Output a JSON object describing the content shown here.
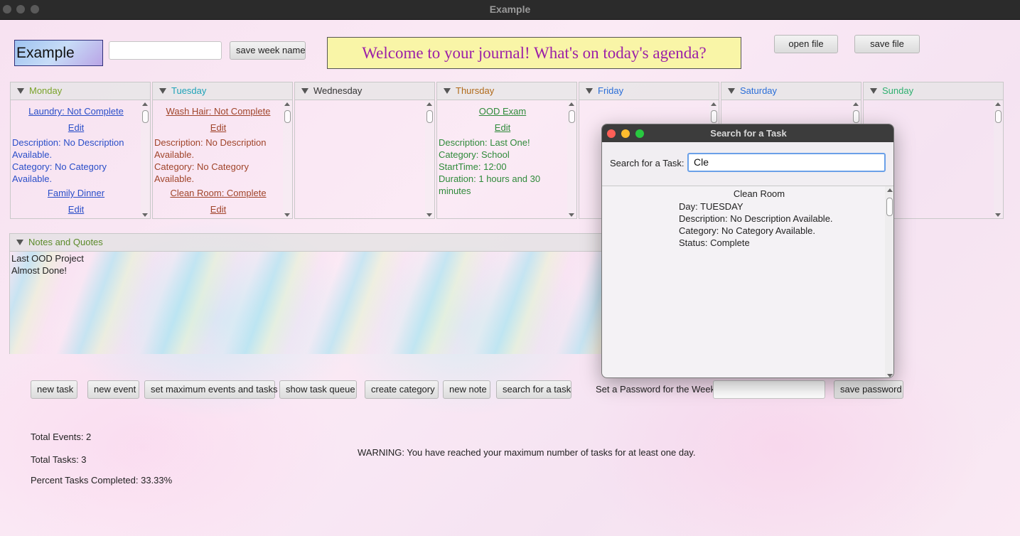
{
  "window": {
    "title": "Example"
  },
  "toolbar": {
    "week_name": "Example",
    "week_name_input_value": "",
    "save_week_name": "save week name",
    "welcome": "Welcome to your journal! What's on today's agenda?",
    "open_file": "open file",
    "save_file": "save file"
  },
  "days": [
    {
      "name": "Monday",
      "color": "#7aa32a",
      "items": [
        {
          "type": "task",
          "label": "Laundry: Not Complete",
          "color": "#2a4ec8"
        },
        {
          "type": "edit",
          "label": "Edit",
          "color": "#2a4ec8"
        },
        {
          "type": "desc",
          "lines": [
            "Description: No Description Available.",
            "Category: No Category Available."
          ],
          "color": "#2a4ec8"
        },
        {
          "type": "task",
          "label": "Family Dinner",
          "color": "#2a4ec8"
        },
        {
          "type": "edit",
          "label": "Edit",
          "color": "#2a4ec8"
        }
      ]
    },
    {
      "name": "Tuesday",
      "color": "#1fa3b8",
      "items": [
        {
          "type": "task",
          "label": "Wash Hair: Not Complete",
          "color": "#a0442a"
        },
        {
          "type": "edit",
          "label": "Edit",
          "color": "#a0442a"
        },
        {
          "type": "desc",
          "lines": [
            "Description: No Description Available.",
            "Category: No Category Available."
          ],
          "color": "#a0442a"
        },
        {
          "type": "task",
          "label": "Clean Room: Complete",
          "color": "#a0442a"
        },
        {
          "type": "edit",
          "label": "Edit",
          "color": "#a0442a"
        }
      ]
    },
    {
      "name": "Wednesday",
      "color": "#333333",
      "items": []
    },
    {
      "name": "Thursday",
      "color": "#b06a1a",
      "items": [
        {
          "type": "task",
          "label": "OOD Exam",
          "color": "#2f8a3a"
        },
        {
          "type": "edit",
          "label": "Edit",
          "color": "#2f8a3a"
        },
        {
          "type": "desc",
          "lines": [
            "Description: Last One!",
            "Category: School",
            "StartTime: 12:00",
            "Duration: 1 hours and 30 minutes"
          ],
          "color": "#2f8a3a"
        }
      ]
    },
    {
      "name": "Friday",
      "color": "#2a6ed8",
      "items": []
    },
    {
      "name": "Saturday",
      "color": "#2a6ed8",
      "items": []
    },
    {
      "name": "Sunday",
      "color": "#2fb070",
      "items": []
    }
  ],
  "notes": {
    "header": "Notes and Quotes",
    "lines": [
      "Last OOD Project",
      "Almost Done!"
    ]
  },
  "actions": {
    "new_task": "new task",
    "new_event": "new event",
    "set_max": "set maximum events and tasks",
    "show_queue": "show task queue",
    "create_category": "create category",
    "new_note": "new note",
    "search_task": "search for a task",
    "password_label": "Set a Password for the Week:",
    "password_value": "",
    "save_password": "save password"
  },
  "stats": {
    "total_events": "Total Events: 2",
    "total_tasks": "Total Tasks: 3",
    "percent": "Percent Tasks Completed: 33.33%"
  },
  "warning": "WARNING: You have reached your maximum number of tasks for at least one day.",
  "search_dialog": {
    "title": "Search for a Task",
    "label": "Search for a Task:",
    "query": "Cle",
    "result": {
      "title": "Clean Room",
      "lines": [
        "Day: TUESDAY",
        "Description: No Description Available.",
        "Category: No Category Available.",
        "Status: Complete"
      ]
    }
  }
}
